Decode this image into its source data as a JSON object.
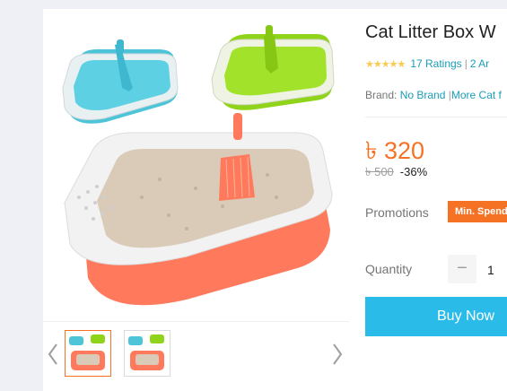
{
  "product": {
    "title": "Cat Litter Box W",
    "rating_stars": "★★★★★",
    "ratings_text": "17 Ratings",
    "separator": "|",
    "answers_text": "2 Ar",
    "brand_label": "Brand:",
    "brand_name": "No Brand",
    "more_text": "More Cat f",
    "rating_value": 4.5
  },
  "price": {
    "current": "৳ 320",
    "original": "৳ 500",
    "discount": "-36%"
  },
  "promotions": {
    "label": "Promotions",
    "badge": "Min. Spend"
  },
  "quantity": {
    "label": "Quantity",
    "minus": "−",
    "value": "1"
  },
  "actions": {
    "buy_now": "Buy Now"
  },
  "gallery": {
    "nav_left_icon": "chevron-left-icon",
    "nav_right_icon": "chevron-right-icon",
    "active_thumb_index": 0
  },
  "colors": {
    "accent": "#f57224",
    "link": "#1a9cb7",
    "buy_button": "#2abbe8",
    "star": "#faca51",
    "box_blue": "#4ec4d8",
    "box_green": "#8fd31a",
    "box_coral": "#ff7a5c"
  }
}
